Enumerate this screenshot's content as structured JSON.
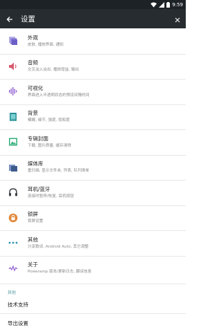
{
  "status": {
    "time": "9:59"
  },
  "header": {
    "title": "设置"
  },
  "items": [
    {
      "title": "外观",
      "subtitle": "皮肤, 播放界面, 通知",
      "icon": "appearance-icon"
    },
    {
      "title": "音频",
      "subtitle": "交叉淡入淡出, 播放增益, 输出",
      "icon": "audio-icon"
    },
    {
      "title": "可视化",
      "subtitle": "界面进入半透明状态的预设间隔时间",
      "icon": "visualization-icon"
    },
    {
      "title": "背景",
      "subtitle": "模糊, 细节, 强度, 饱和度",
      "icon": "background-icon"
    },
    {
      "title": "专辑封面",
      "subtitle": "下载, 图片质量, 缓存清除",
      "icon": "album-art-icon"
    },
    {
      "title": "媒体库",
      "subtitle": "重扫描, 显示文件夹, 列表, 队列清单",
      "icon": "library-icon"
    },
    {
      "title": "耳机/蓝牙",
      "subtitle": "连接时暂停/恢复, 耳机按钮",
      "icon": "headphones-icon"
    },
    {
      "title": "锁屏",
      "subtitle": "锁屏设置",
      "icon": "lock-icon"
    },
    {
      "title": "其他",
      "subtitle": "分享歌词, Android Auto, 其它调整",
      "icon": "more-icon"
    },
    {
      "title": "关于",
      "subtitle": "Poweramp 版本/更新日志, 翻译信息",
      "icon": "about-icon"
    }
  ],
  "other_section": {
    "label": "其他",
    "items": [
      "技术支持",
      "导出设置"
    ]
  },
  "colors": {
    "statusbar": "#1d2226",
    "appbar": "#262c30",
    "accent_purple": "#6b5fc7",
    "accent_red": "#d65a6f",
    "accent_teal": "#2aa6a0",
    "accent_blue": "#3d5a8c",
    "accent_orange": "#e1893c",
    "section_label": "#5aa0a6"
  }
}
